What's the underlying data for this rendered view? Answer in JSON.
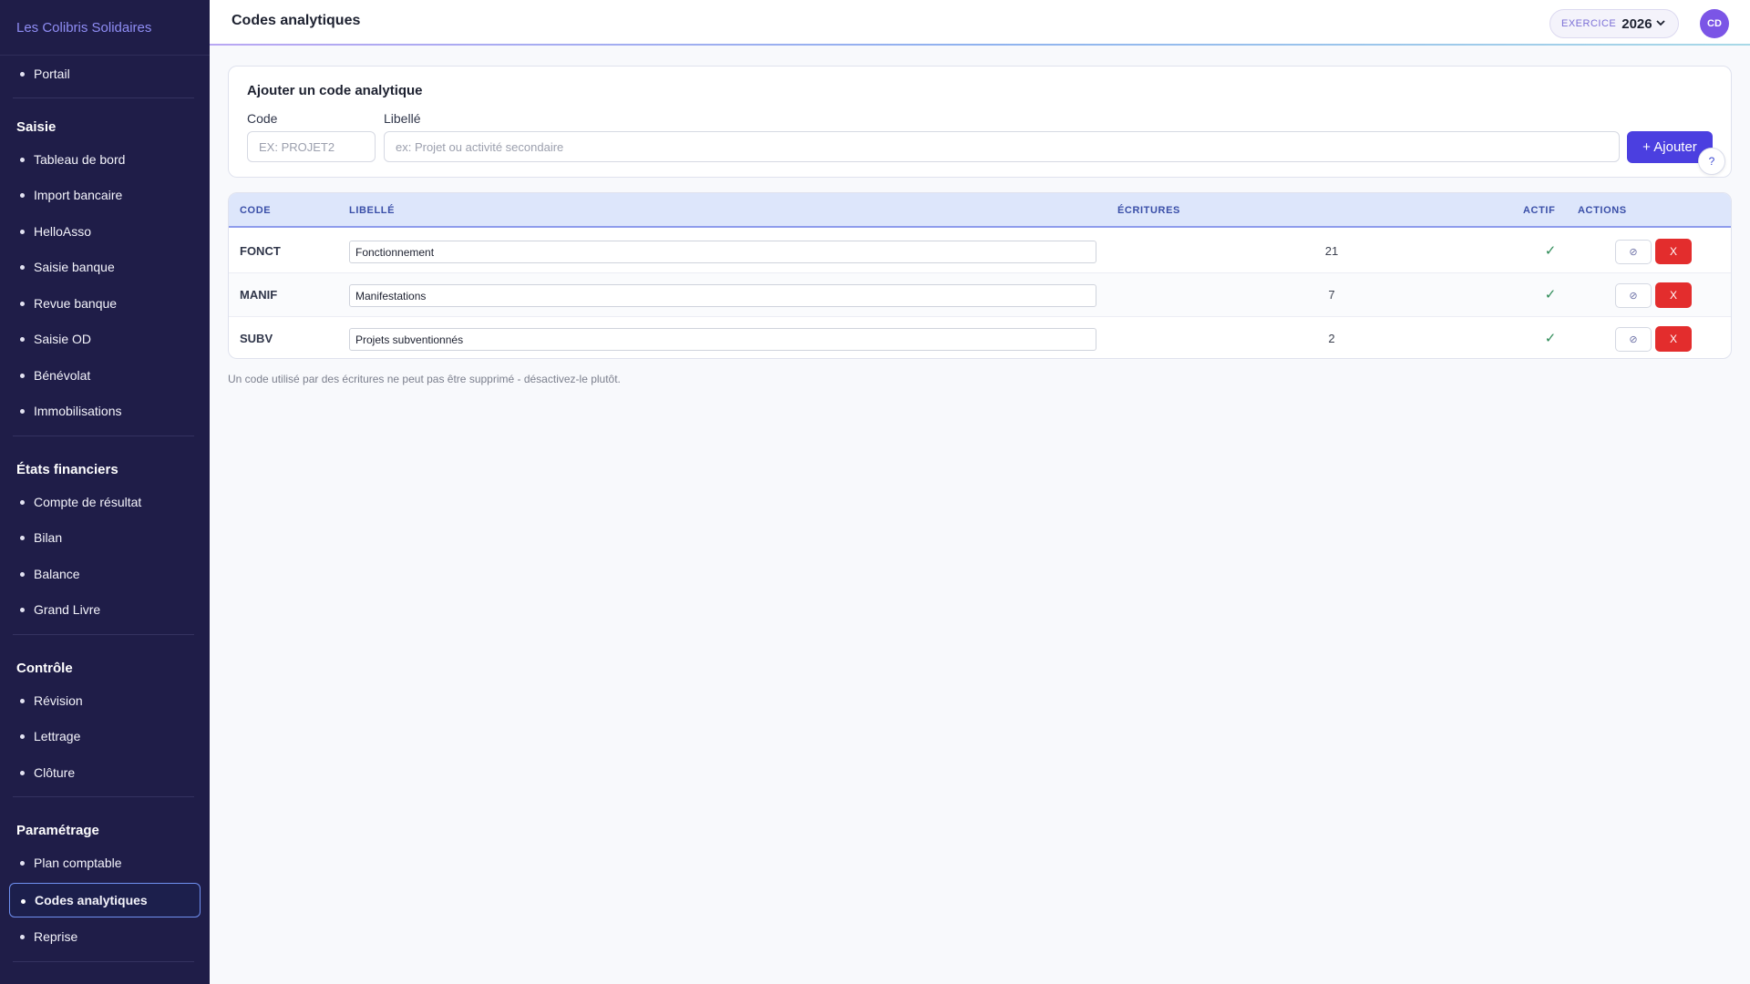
{
  "sidebar": {
    "brand": "Les Colibris Solidaires",
    "portal": "Portail",
    "sections": [
      {
        "title": "Saisie",
        "items": [
          "Tableau de bord",
          "Import bancaire",
          "HelloAsso",
          "Saisie banque",
          "Revue banque",
          "Saisie OD",
          "Bénévolat",
          "Immobilisations"
        ]
      },
      {
        "title": "États financiers",
        "items": [
          "Compte de résultat",
          "Bilan",
          "Balance",
          "Grand Livre"
        ]
      },
      {
        "title": "Contrôle",
        "items": [
          "Révision",
          "Lettrage",
          "Clôture"
        ]
      },
      {
        "title": "Paramétrage",
        "items": [
          "Plan comptable",
          "Codes analytiques",
          "Reprise"
        ]
      }
    ],
    "active_item": "Codes analytiques"
  },
  "header": {
    "title": "Codes analytiques",
    "exercise_label": "EXERCICE",
    "exercise_year": "2026",
    "avatar_initials": "CD"
  },
  "add_form": {
    "title": "Ajouter un code analytique",
    "code_label": "Code",
    "code_placeholder": "EX: PROJET2",
    "libelle_label": "Libellé",
    "libelle_placeholder": "ex: Projet ou activité secondaire",
    "submit_label": "+ Ajouter",
    "help_label": "?"
  },
  "table": {
    "columns": [
      "CODE",
      "LIBELLÉ",
      "ÉCRITURES",
      "ACTIF",
      "ACTIONS"
    ],
    "rows": [
      {
        "code": "FONCT",
        "libelle": "Fonctionnement",
        "ecritures": "21",
        "actif": "✓",
        "deactivate_icon": "⊘",
        "delete_label": "X"
      },
      {
        "code": "MANIF",
        "libelle": "Manifestations",
        "ecritures": "7",
        "actif": "✓",
        "deactivate_icon": "⊘",
        "delete_label": "X"
      },
      {
        "code": "SUBV",
        "libelle": "Projets subventionnés",
        "ecritures": "2",
        "actif": "✓",
        "deactivate_icon": "⊘",
        "delete_label": "X"
      }
    ]
  },
  "footnote": "Un code utilisé par des écritures ne peut pas être supprimé - désactivez-le plutôt.",
  "colors": {
    "sidebar_bg": "#1f1d48",
    "accent": "#4b3fe0",
    "danger": "#e32d2d",
    "brand_text": "#8f8df4"
  }
}
